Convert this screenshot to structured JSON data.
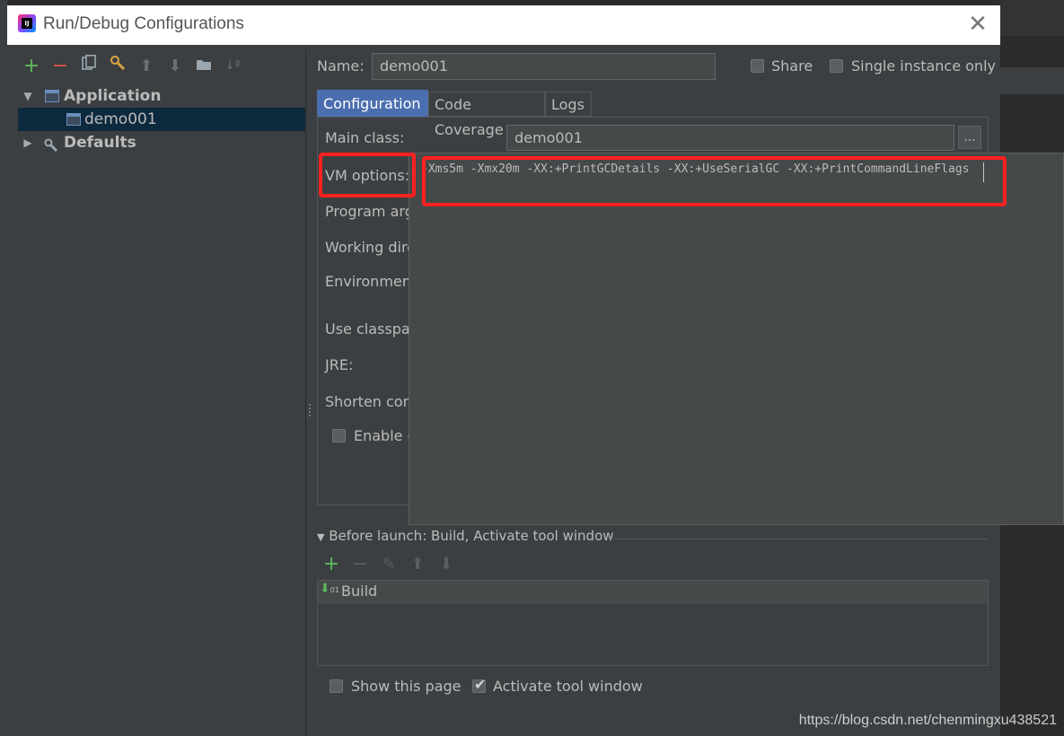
{
  "window": {
    "title": "Run/Debug Configurations",
    "close_icon": "close-icon"
  },
  "toolbar": {
    "icons": [
      "add-icon",
      "remove-icon",
      "copy-icon",
      "settings-icon",
      "move-up-icon",
      "move-down-icon",
      "folder-icon",
      "sort-icon"
    ]
  },
  "tree": {
    "items": [
      {
        "label": "Application",
        "expanded": true
      },
      {
        "label": "demo001",
        "selected": true
      },
      {
        "label": "Defaults",
        "expanded": false
      }
    ]
  },
  "header": {
    "name_label": "Name:",
    "name_value": "demo001",
    "share_label": "Share",
    "single_instance_label": "Single instance only"
  },
  "tabs": [
    "Configuration",
    "Code Coverage",
    "Logs"
  ],
  "config": {
    "main_class_label": "Main class:",
    "main_class_value": "demo001",
    "ellipsis": "...",
    "vm_options_label": "VM options:",
    "vm_options_value": "-Xms5m -Xmx20m -XX:+PrintGCDetails -XX:+UseSerialGC -XX:+PrintCommandLineFlags",
    "program_args_label": "Program argu",
    "working_dir_label": "Working dire",
    "environment_label": "Environment",
    "classpath_label": "Use classpath",
    "jre_label": "JRE:",
    "shorten_label": "Shorten comm",
    "enable_label": "Enable ca"
  },
  "before_launch": {
    "header": "Before launch: Build, Activate tool window",
    "items": [
      "Build"
    ]
  },
  "footer": {
    "show_page_label": "Show this page",
    "activate_label": "Activate tool window"
  },
  "watermark": "https://blog.csdn.net/chenmingxu438521",
  "colors": {
    "accent": "#4b6eaf",
    "highlight": "#ff2020",
    "selected_row": "#0d293e"
  }
}
